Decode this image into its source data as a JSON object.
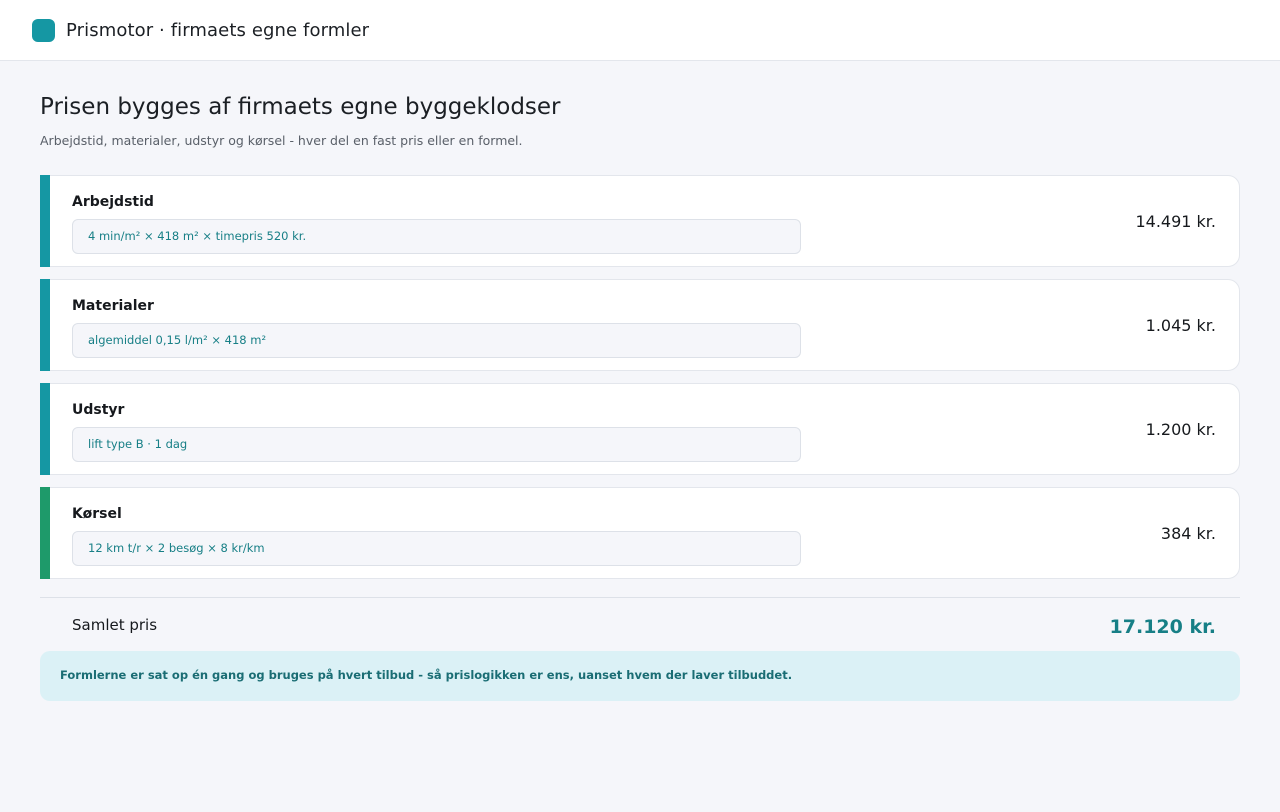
{
  "app": {
    "title": "Prismotor · firmaets egne formler",
    "logo_color": "#1597a3"
  },
  "page": {
    "heading": "Prisen bygges af firmaets egne byggeklodser",
    "subheading": "Arbejdstid, materialer, udstyr og kørsel - hver del en fast pris eller en formel."
  },
  "colors": {
    "accent_teal": "#1597a3",
    "accent_green": "#1e9a6a",
    "formula_text": "#177f86",
    "total_text": "#177f86",
    "note_bg": "#dbf1f6",
    "note_text": "#1a6d74"
  },
  "components": [
    {
      "label": "Arbejdstid",
      "formula": "4 min/m² × 418 m² × timepris 520 kr.",
      "amount": "14.491 kr.",
      "bar_color": "#1597a3"
    },
    {
      "label": "Materialer",
      "formula": "algemiddel 0,15 l/m² × 418 m²",
      "amount": "1.045 kr.",
      "bar_color": "#1597a3"
    },
    {
      "label": "Udstyr",
      "formula": "lift type B · 1 dag",
      "amount": "1.200 kr.",
      "bar_color": "#1597a3"
    },
    {
      "label": "Kørsel",
      "formula": "12 km t/r × 2 besøg × 8 kr/km",
      "amount": "384 kr.",
      "bar_color": "#1e9a6a"
    }
  ],
  "total": {
    "label": "Samlet pris",
    "amount": "17.120 kr."
  },
  "note": {
    "text": "Formlerne er sat op én gang og bruges på hvert tilbud - så prislogikken er ens, uanset hvem der laver tilbuddet."
  }
}
